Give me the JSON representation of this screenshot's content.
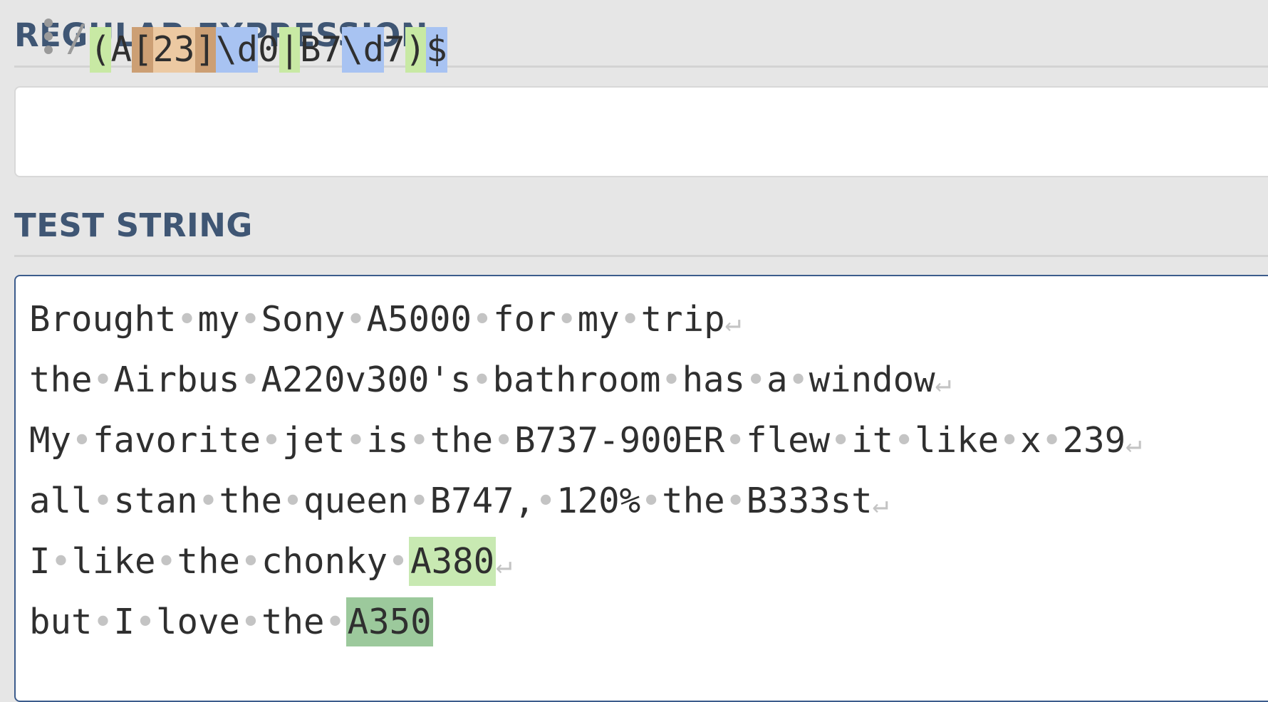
{
  "regex_section": {
    "title": "REGULAR EXPRESSION",
    "delimiter": "/",
    "tokens": [
      {
        "text": "(",
        "kind": "group"
      },
      {
        "text": "A",
        "kind": "literal"
      },
      {
        "text": "[",
        "kind": "set-bracket"
      },
      {
        "text": "23",
        "kind": "set"
      },
      {
        "text": "]",
        "kind": "set-bracket"
      },
      {
        "text": "\\d",
        "kind": "escape"
      },
      {
        "text": "0",
        "kind": "literal"
      },
      {
        "text": "|",
        "kind": "alternation"
      },
      {
        "text": "B7",
        "kind": "literal"
      },
      {
        "text": "\\d",
        "kind": "escape"
      },
      {
        "text": "7",
        "kind": "literal"
      },
      {
        "text": ")",
        "kind": "group"
      },
      {
        "text": "$",
        "kind": "escape"
      }
    ]
  },
  "test_section": {
    "title": "TEST STRING",
    "lines": [
      {
        "segments": [
          {
            "text": "Brought my Sony A5000 for my trip"
          }
        ],
        "newline": true
      },
      {
        "segments": [
          {
            "text": "the Airbus A220v300's bathroom has a window"
          }
        ],
        "newline": true
      },
      {
        "segments": [
          {
            "text": "My favorite jet is the B737-900ER flew it like x 239"
          }
        ],
        "newline": true
      },
      {
        "segments": [
          {
            "text": "all stan the queen B747, 120% the B333st"
          }
        ],
        "newline": true
      },
      {
        "segments": [
          {
            "text": "I like the chonky "
          },
          {
            "text": "A380",
            "match": 1
          }
        ],
        "newline": true
      },
      {
        "segments": [
          {
            "text": "but I love the "
          },
          {
            "text": "A350",
            "match": 2
          }
        ],
        "newline": false
      }
    ]
  },
  "colors": {
    "title": "#3f5674",
    "group": "#c8e9a4",
    "set": "#ecc9a2",
    "escape": "#a8c3f2",
    "match_a": "#c8e9b2",
    "match_b": "#9cc99c",
    "active_border": "#3c5c8c"
  },
  "icons": {
    "drag_handle": "vertical-dots-icon",
    "whitespace": "middle-dot",
    "newline": "return-arrow-icon"
  }
}
